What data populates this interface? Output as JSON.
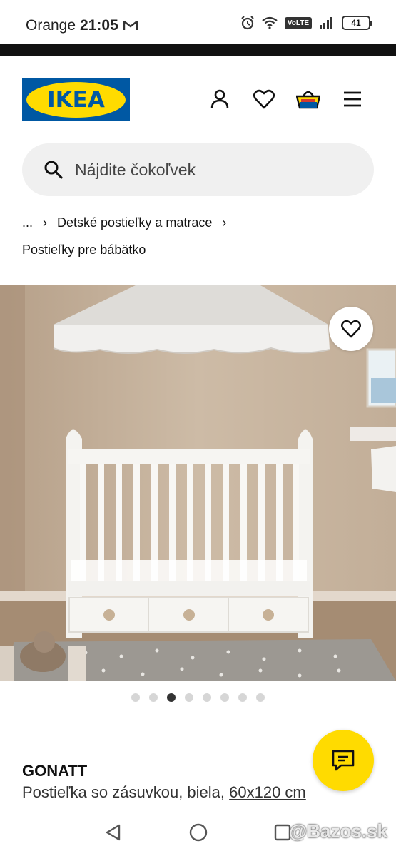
{
  "status_bar": {
    "carrier": "Orange",
    "time": "21:05",
    "volte": "VoLTE",
    "battery": "41"
  },
  "header": {
    "logo_text": "IKEA",
    "icons": [
      "profile-icon",
      "heart-icon",
      "basket-icon",
      "menu-icon"
    ]
  },
  "search": {
    "placeholder": "Nájdite čokoľvek"
  },
  "breadcrumb": {
    "ellipsis": "...",
    "category": "Detské postieľky a matrace",
    "subcategory": "Postieľky pre bábätko"
  },
  "gallery": {
    "total_images": 8,
    "active_index": 2
  },
  "product": {
    "name": "GONATT",
    "description": "Postieľka so zásuvkou, biela,",
    "size": "60x120 cm"
  },
  "watermark": "@Bazos.sk",
  "colors": {
    "ikea_blue": "#0058a3",
    "ikea_yellow": "#ffdb00"
  }
}
